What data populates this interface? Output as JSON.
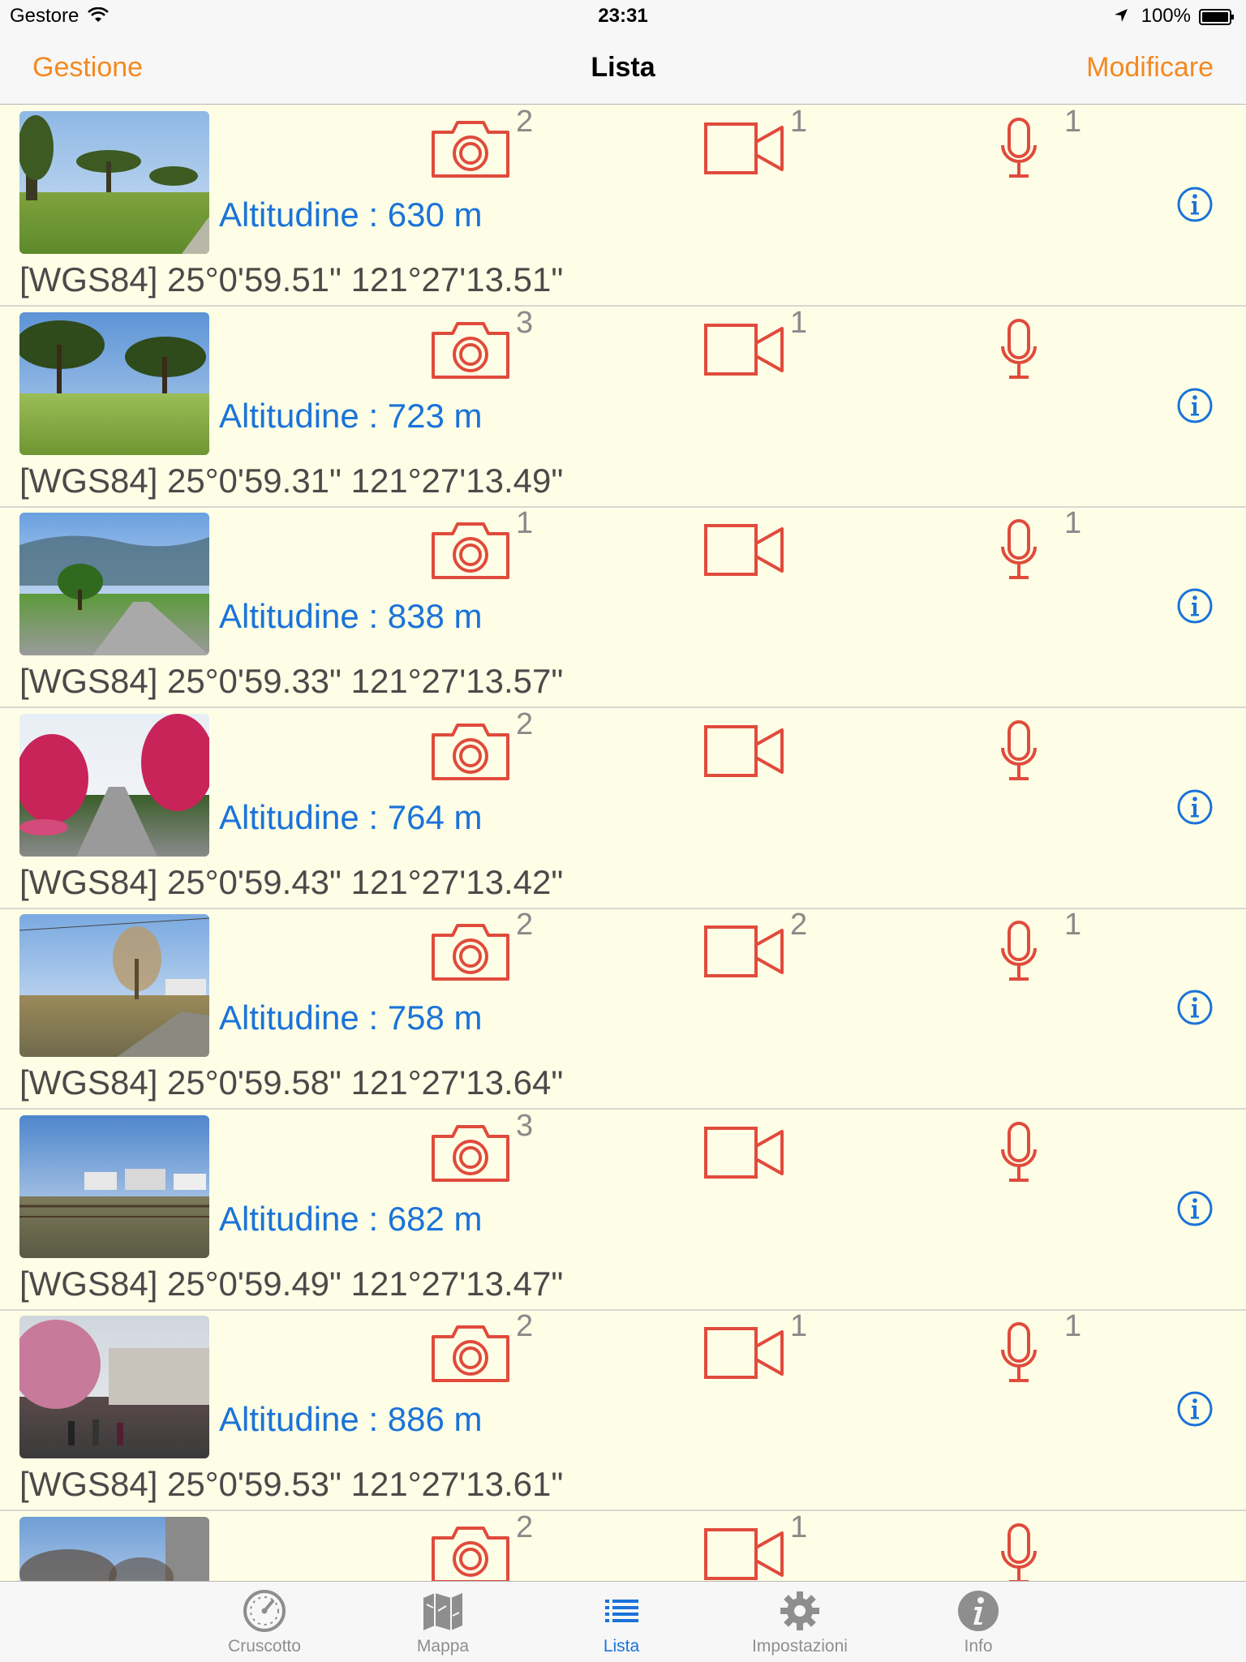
{
  "status_bar": {
    "carrier": "Gestore",
    "time": "23:31",
    "battery": "100%"
  },
  "nav": {
    "left": "Gestione",
    "title": "Lista",
    "right": "Modificare"
  },
  "colors": {
    "accent": "#f5891f",
    "icon_red": "#e04b3c",
    "link_blue": "#1a73d9",
    "list_background": "#fefee6"
  },
  "rows": [
    {
      "photo_count": "2",
      "video_count": "1",
      "audio_count": "1",
      "altitude": "Altitudine : 630 m",
      "coords": "[WGS84] 25°0'59.51\" 121°27'13.51\""
    },
    {
      "photo_count": "3",
      "video_count": "1",
      "audio_count": "",
      "altitude": "Altitudine : 723 m",
      "coords": "[WGS84] 25°0'59.31\" 121°27'13.49\""
    },
    {
      "photo_count": "1",
      "video_count": "",
      "audio_count": "1",
      "altitude": "Altitudine : 838 m",
      "coords": "[WGS84] 25°0'59.33\" 121°27'13.57\""
    },
    {
      "photo_count": "2",
      "video_count": "",
      "audio_count": "",
      "altitude": "Altitudine : 764 m",
      "coords": "[WGS84] 25°0'59.43\" 121°27'13.42\""
    },
    {
      "photo_count": "2",
      "video_count": "2",
      "audio_count": "1",
      "altitude": "Altitudine : 758 m",
      "coords": "[WGS84] 25°0'59.58\" 121°27'13.64\""
    },
    {
      "photo_count": "3",
      "video_count": "",
      "audio_count": "",
      "altitude": "Altitudine : 682 m",
      "coords": "[WGS84] 25°0'59.49\" 121°27'13.47\""
    },
    {
      "photo_count": "2",
      "video_count": "1",
      "audio_count": "1",
      "altitude": "Altitudine : 886 m",
      "coords": "[WGS84] 25°0'59.53\" 121°27'13.61\""
    },
    {
      "photo_count": "2",
      "video_count": "1",
      "audio_count": "",
      "altitude": "",
      "coords": ""
    }
  ],
  "tabs": [
    {
      "label": "Cruscotto",
      "icon": "gauge-icon"
    },
    {
      "label": "Mappa",
      "icon": "map-icon"
    },
    {
      "label": "Lista",
      "icon": "list-icon",
      "active": true
    },
    {
      "label": "Impostazioni",
      "icon": "gear-icon"
    },
    {
      "label": "Info",
      "icon": "info-icon"
    }
  ]
}
